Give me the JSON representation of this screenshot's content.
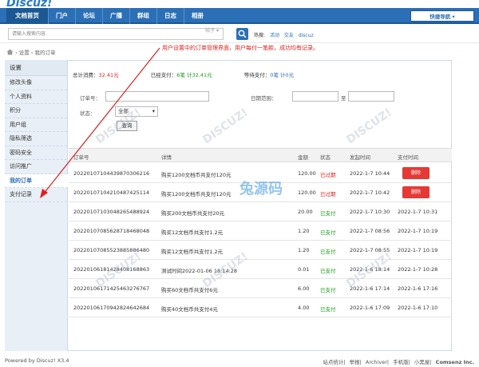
{
  "brand": {
    "logo_text": "Discuz!",
    "accent": "#2b6fb6",
    "danger": "#e53935"
  },
  "nav": {
    "items": [
      {
        "label": "文档首页",
        "active": true
      },
      {
        "label": "门户"
      },
      {
        "label": "论坛"
      },
      {
        "label": "广播"
      },
      {
        "label": "群组"
      },
      {
        "label": "日志"
      },
      {
        "label": "相册"
      }
    ],
    "quick_nav": "快捷导航 ▾"
  },
  "search": {
    "placeholder": "请输入搜索内容",
    "type": "帖子 ▾",
    "hot_label": "热搜:",
    "hot_terms": [
      "活动",
      "交友",
      "discuz"
    ]
  },
  "breadcrumb": {
    "text": "› 设置 › 我的订单"
  },
  "annotation": "用户设置中的订单管理界面，用户每付一笔款，成功均有记录。",
  "sidebar": {
    "title": "设置",
    "items": [
      {
        "label": "修改头像"
      },
      {
        "label": "个人资料"
      },
      {
        "label": "积分"
      },
      {
        "label": "用户组"
      },
      {
        "label": "隐私筛选"
      },
      {
        "label": "密码安全"
      },
      {
        "label": "访问推广"
      },
      {
        "label": "我的订单",
        "active": true
      },
      {
        "label": "支付记录"
      }
    ]
  },
  "summary": {
    "total_label": "总计消费：",
    "total_value": "32.41元",
    "paid_label": "已经支付：",
    "paid_value": "6笔 计32.41元",
    "pending_label": "等待支付：",
    "pending_value": "0笔 计0元"
  },
  "filter": {
    "order_no_label": "订单号：",
    "status_label": "状态：",
    "status_value": "全部",
    "date_label": "日期范围：",
    "date_to": "至",
    "query_button": "查询"
  },
  "table": {
    "headers": [
      "订单号",
      "详情",
      "金额",
      "状态",
      "发起时间",
      "支付时间"
    ],
    "rows": [
      {
        "order_no": "20220107104439870306216",
        "detail": "购买1200文档币共支付120元",
        "amount": "120.00",
        "status": "已过期",
        "created": "2022-1-7 10:44",
        "paid": "",
        "action": "删除"
      },
      {
        "order_no": "20220107104210487425114",
        "detail": "购买1200文档币共支付120元",
        "amount": "120.00",
        "status": "已过期",
        "created": "2022-1-7 10:42",
        "paid": "",
        "action": "删除"
      },
      {
        "order_no": "20220107103048265488924",
        "detail": "购买200文档币共支付20元",
        "amount": "20.00",
        "status": "已支付",
        "created": "2022-1-7 10:30",
        "paid": "2022-1-7 10:31"
      },
      {
        "order_no": "20220107085628718468048",
        "detail": "购买12文档币共支付1.2元",
        "amount": "1.20",
        "status": "已支付",
        "created": "2022-1-7 08:56",
        "paid": "2022-1-7 10:19"
      },
      {
        "order_no": "20220107085523885886480",
        "detail": "购买12文档币共支付1.2元",
        "amount": "1.20",
        "status": "已支付",
        "created": "2022-1-7 08:55",
        "paid": "2022-1-7 10:19"
      },
      {
        "order_no": "20220106181428408168863",
        "detail": "测试时间2022-01-06 18:14:28",
        "amount": "0.01",
        "status": "已支付",
        "created": "2022-1-6 18:14",
        "paid": "2022-1-7 10:28"
      },
      {
        "order_no": "20220106171425463276767",
        "detail": "购买60文档币共支付6元",
        "amount": "6.00",
        "status": "已支付",
        "created": "2022-1-6 17:14",
        "paid": "2022-1-6 17:16"
      },
      {
        "order_no": "20220106170942824642684",
        "detail": "购买40文档币共支付4元",
        "amount": "4.00",
        "status": "已支付",
        "created": "2022-1-6 17:09",
        "paid": "2022-1-6 17:10"
      }
    ]
  },
  "footer": {
    "powered": "Powered by Discuz! X3.4",
    "links": [
      "站点统计",
      "举报",
      "Archiver",
      "手机版",
      "小黑屋",
      "Comsenz Inc."
    ]
  },
  "watermarks": {
    "center": "兔源码"
  }
}
